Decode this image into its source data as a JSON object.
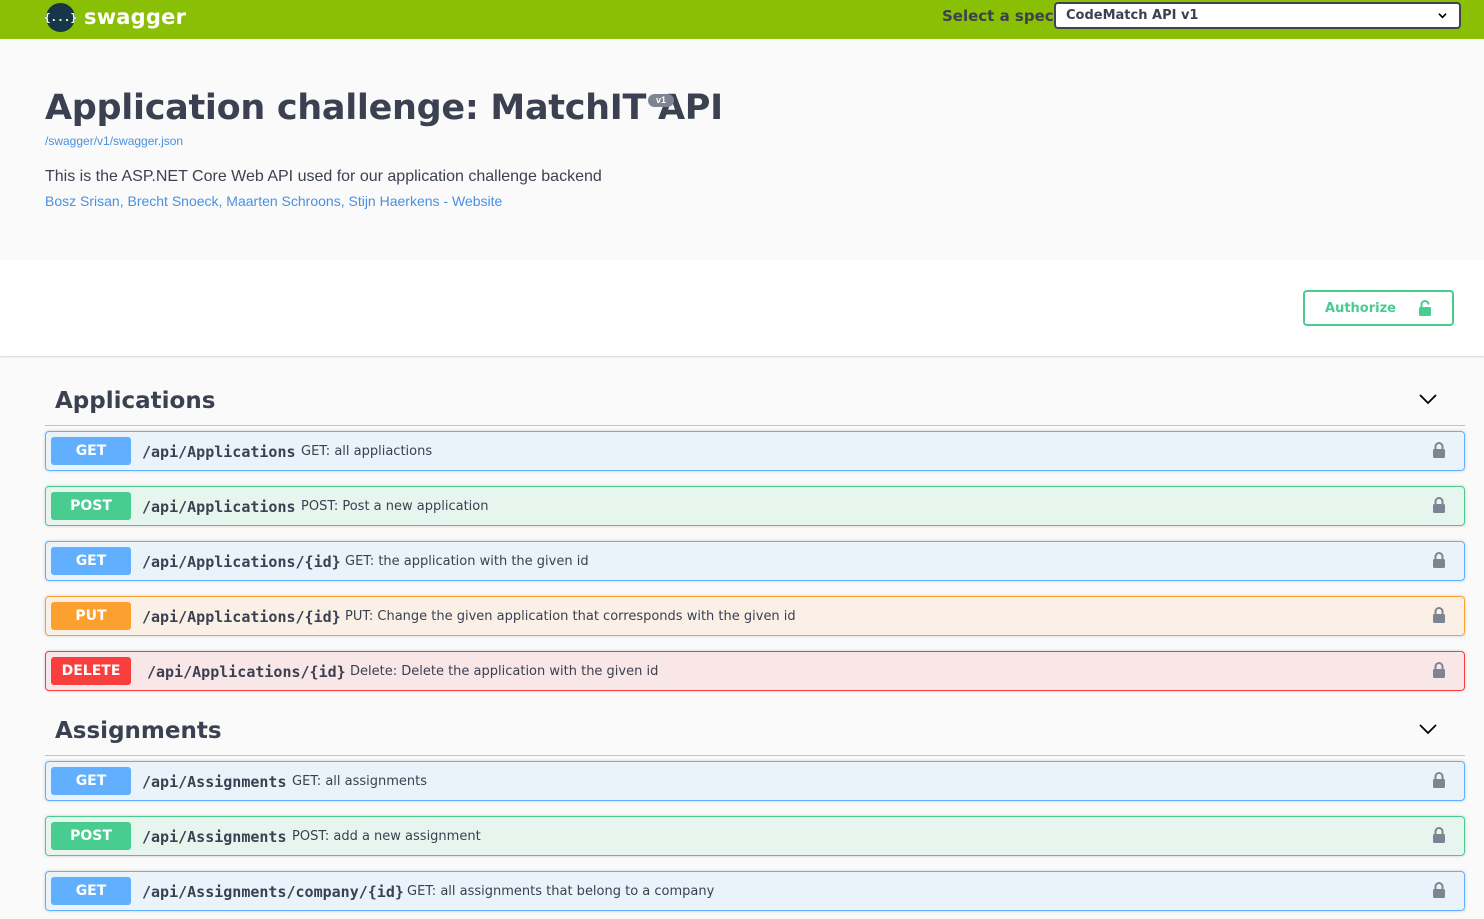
{
  "topbar": {
    "logo_text": "swagger",
    "logo_glyph": "{...}",
    "spec_label": "Select a spec",
    "spec_selected": "CodeMatch API v1"
  },
  "info": {
    "title": "Application challenge: MatchIT API",
    "version": "v1",
    "spec_url": "/swagger/v1/swagger.json",
    "description": "This is the ASP.NET Core Web API used for our application challenge backend",
    "contacts": "Bosz Srisan, Brecht Snoeck, Maarten Schroons, Stijn Haerkens",
    "contact_sep": " - ",
    "website": "Website"
  },
  "authorize": {
    "label": "Authorize"
  },
  "tags": [
    {
      "name": "Applications",
      "operations": [
        {
          "method": "GET",
          "path": "/api/Applications",
          "summary": "GET: all appliactions"
        },
        {
          "method": "POST",
          "path": "/api/Applications",
          "summary": "POST: Post a new application"
        },
        {
          "method": "GET",
          "path": "/api/Applications/{id}",
          "summary": "GET: the application with the given id"
        },
        {
          "method": "PUT",
          "path": "/api/Applications/{id}",
          "summary": "PUT: Change the given application that corresponds with the given id"
        },
        {
          "method": "DELETE",
          "path": "/api/Applications/{id}",
          "summary": "Delete: Delete the application with the given id"
        }
      ]
    },
    {
      "name": "Assignments",
      "operations": [
        {
          "method": "GET",
          "path": "/api/Assignments",
          "summary": "GET: all assignments"
        },
        {
          "method": "POST",
          "path": "/api/Assignments",
          "summary": "POST: add a new assignment"
        },
        {
          "method": "GET",
          "path": "/api/Assignments/company/{id}",
          "summary": "GET: all assignments that belong to a company"
        }
      ]
    }
  ],
  "colors": {
    "topbar": "#89bf04",
    "get": "#61affe",
    "post": "#49cc90",
    "put": "#fca130",
    "delete": "#f93e3e"
  },
  "icons": {
    "logo": "swagger-logo-icon",
    "spec_dropdown": "chevron-down-icon",
    "authorize": "lock-icon",
    "tag_toggle": "chevron-down-icon",
    "operation_lock": "lock-icon"
  }
}
